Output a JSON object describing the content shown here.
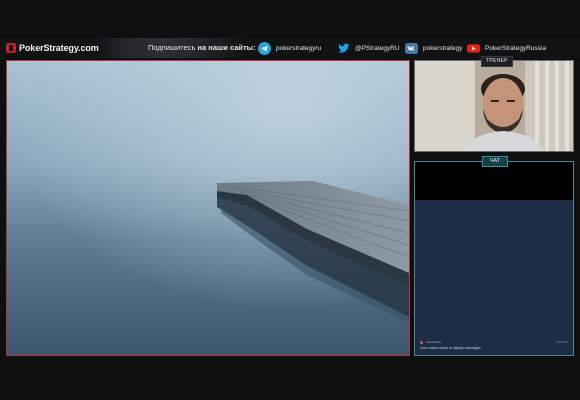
{
  "brand": {
    "name": "PokerStrategy.com",
    "logo_color": "#c21f2f"
  },
  "header": {
    "subscribe_prefix": "Подпишитесь",
    "subscribe_bold": "на наши сайты:",
    "socials": [
      {
        "name": "telegram",
        "icon": "telegram-icon",
        "label": "pokerstrategyru",
        "color": "#2aa3dc"
      },
      {
        "name": "twitter",
        "icon": "twitter-icon",
        "label": "@PStrategyRU",
        "color": "#1da1f2"
      },
      {
        "name": "vk",
        "icon": "vk-icon",
        "label": "pokerstrategy",
        "color": "#4a76a8"
      },
      {
        "name": "youtube",
        "icon": "youtube-icon",
        "label": "PokerStrategyRussia",
        "color": "#e62117"
      }
    ]
  },
  "webcam": {
    "tag": "ТРЕНЕР"
  },
  "chat": {
    "tag": "ЧАТ",
    "message": {
      "user": "Streamlabs",
      "time": "12:00 AM",
      "text": "Your chat is ready to display messages"
    }
  },
  "colors": {
    "main_border": "#b83042",
    "chat_border": "#4b8a95",
    "chat_bg": "#1c2d45"
  }
}
